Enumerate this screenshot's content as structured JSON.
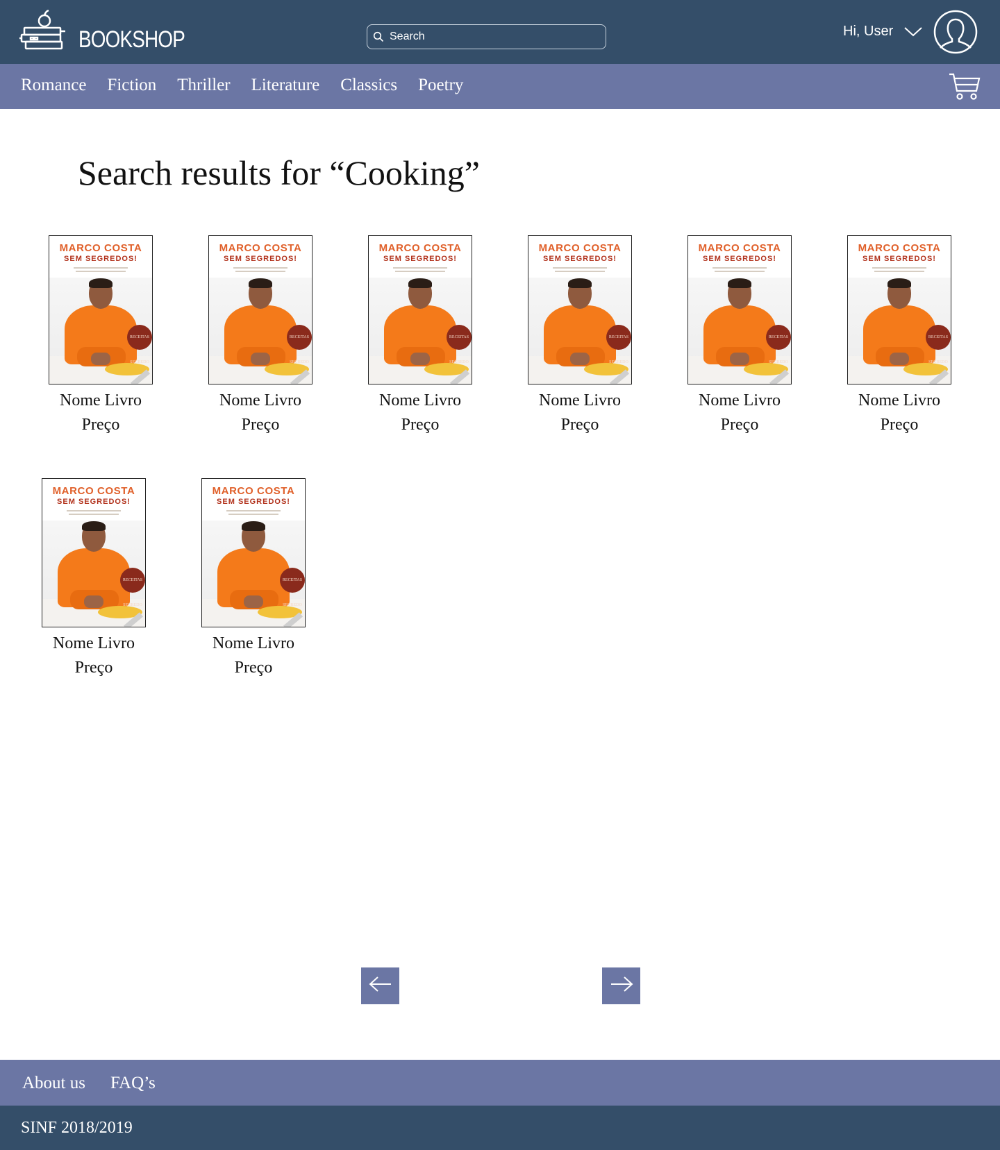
{
  "header": {
    "brand": "BOOKSHOP",
    "search_placeholder": "Search",
    "greeting": "Hi, User"
  },
  "nav": {
    "categories": [
      "Romance",
      "Fiction",
      "Thriller",
      "Literature",
      "Classics",
      "Poetry"
    ]
  },
  "main": {
    "title": "Search results for “Cooking”",
    "books": [
      {
        "name": "Nome Livro",
        "price": "Preço",
        "cover_author": "MARCO COSTA",
        "cover_title": "SEM SEGREDOS!",
        "cover_badge": "RECEITAS SEGREDO"
      },
      {
        "name": "Nome Livro",
        "price": "Preço",
        "cover_author": "MARCO COSTA",
        "cover_title": "SEM SEGREDOS!",
        "cover_badge": "RECEITAS SEGREDO"
      },
      {
        "name": "Nome Livro",
        "price": "Preço",
        "cover_author": "MARCO COSTA",
        "cover_title": "SEM SEGREDOS!",
        "cover_badge": "RECEITAS SEGREDO"
      },
      {
        "name": "Nome Livro",
        "price": "Preço",
        "cover_author": "MARCO COSTA",
        "cover_title": "SEM SEGREDOS!",
        "cover_badge": "RECEITAS SEGREDO"
      },
      {
        "name": "Nome Livro",
        "price": "Preço",
        "cover_author": "MARCO COSTA",
        "cover_title": "SEM SEGREDOS!",
        "cover_badge": "RECEITAS SEGREDO"
      },
      {
        "name": "Nome Livro",
        "price": "Preço",
        "cover_author": "MARCO COSTA",
        "cover_title": "SEM SEGREDOS!",
        "cover_badge": "RECEITAS SEGREDO"
      },
      {
        "name": "Nome Livro",
        "price": "Preço",
        "cover_author": "MARCO COSTA",
        "cover_title": "SEM SEGREDOS!",
        "cover_badge": "RECEITAS SEGREDO"
      },
      {
        "name": "Nome Livro",
        "price": "Preço",
        "cover_author": "MARCO COSTA",
        "cover_title": "SEM SEGREDOS!",
        "cover_badge": "RECEITAS SEGREDO"
      }
    ]
  },
  "pagination": {
    "prev_icon": "arrow-left-icon",
    "next_icon": "arrow-right-icon"
  },
  "footer": {
    "links": [
      "About us",
      "FAQ’s"
    ],
    "copyright": "SINF 2018/2019"
  },
  "colors": {
    "header_bg": "#344e69",
    "nav_bg": "#6b76a4",
    "accent": "#6b76a4",
    "cover_orange": "#e0602a"
  }
}
